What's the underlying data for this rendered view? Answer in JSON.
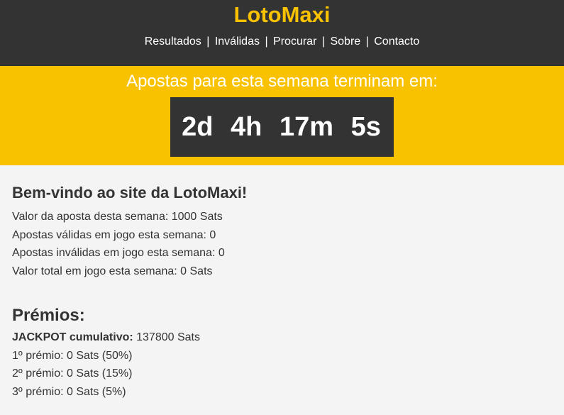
{
  "header": {
    "brand": "LotoMaxi",
    "nav": [
      {
        "label": "Resultados"
      },
      {
        "label": "Inválidas"
      },
      {
        "label": "Procurar"
      },
      {
        "label": "Sobre"
      },
      {
        "label": "Contacto"
      }
    ],
    "separator": "|"
  },
  "countdown": {
    "title": "Apostas para esta semana terminam em:",
    "days": "2d",
    "hours": "4h",
    "minutes": "17m",
    "seconds": "5s"
  },
  "welcome": {
    "title": "Bem-vindo ao site da LotoMaxi!",
    "lines": [
      "Valor da aposta desta semana: 1000 Sats",
      "Apostas válidas em jogo esta semana: 0",
      "Apostas inválidas em jogo esta semana: 0",
      "Valor total em jogo esta semana: 0 Sats"
    ]
  },
  "prizes": {
    "title": "Prémios:",
    "jackpot_label": "JACKPOT cumulativo:",
    "jackpot_value": " 137800 Sats",
    "lines": [
      "1º prémio: 0 Sats (50%)",
      "2º prémio: 0 Sats (15%)",
      "3º prémio: 0 Sats (5%)"
    ]
  },
  "colors": {
    "accent": "#f9c200",
    "dark": "#333333",
    "background": "#f4f4f4"
  }
}
